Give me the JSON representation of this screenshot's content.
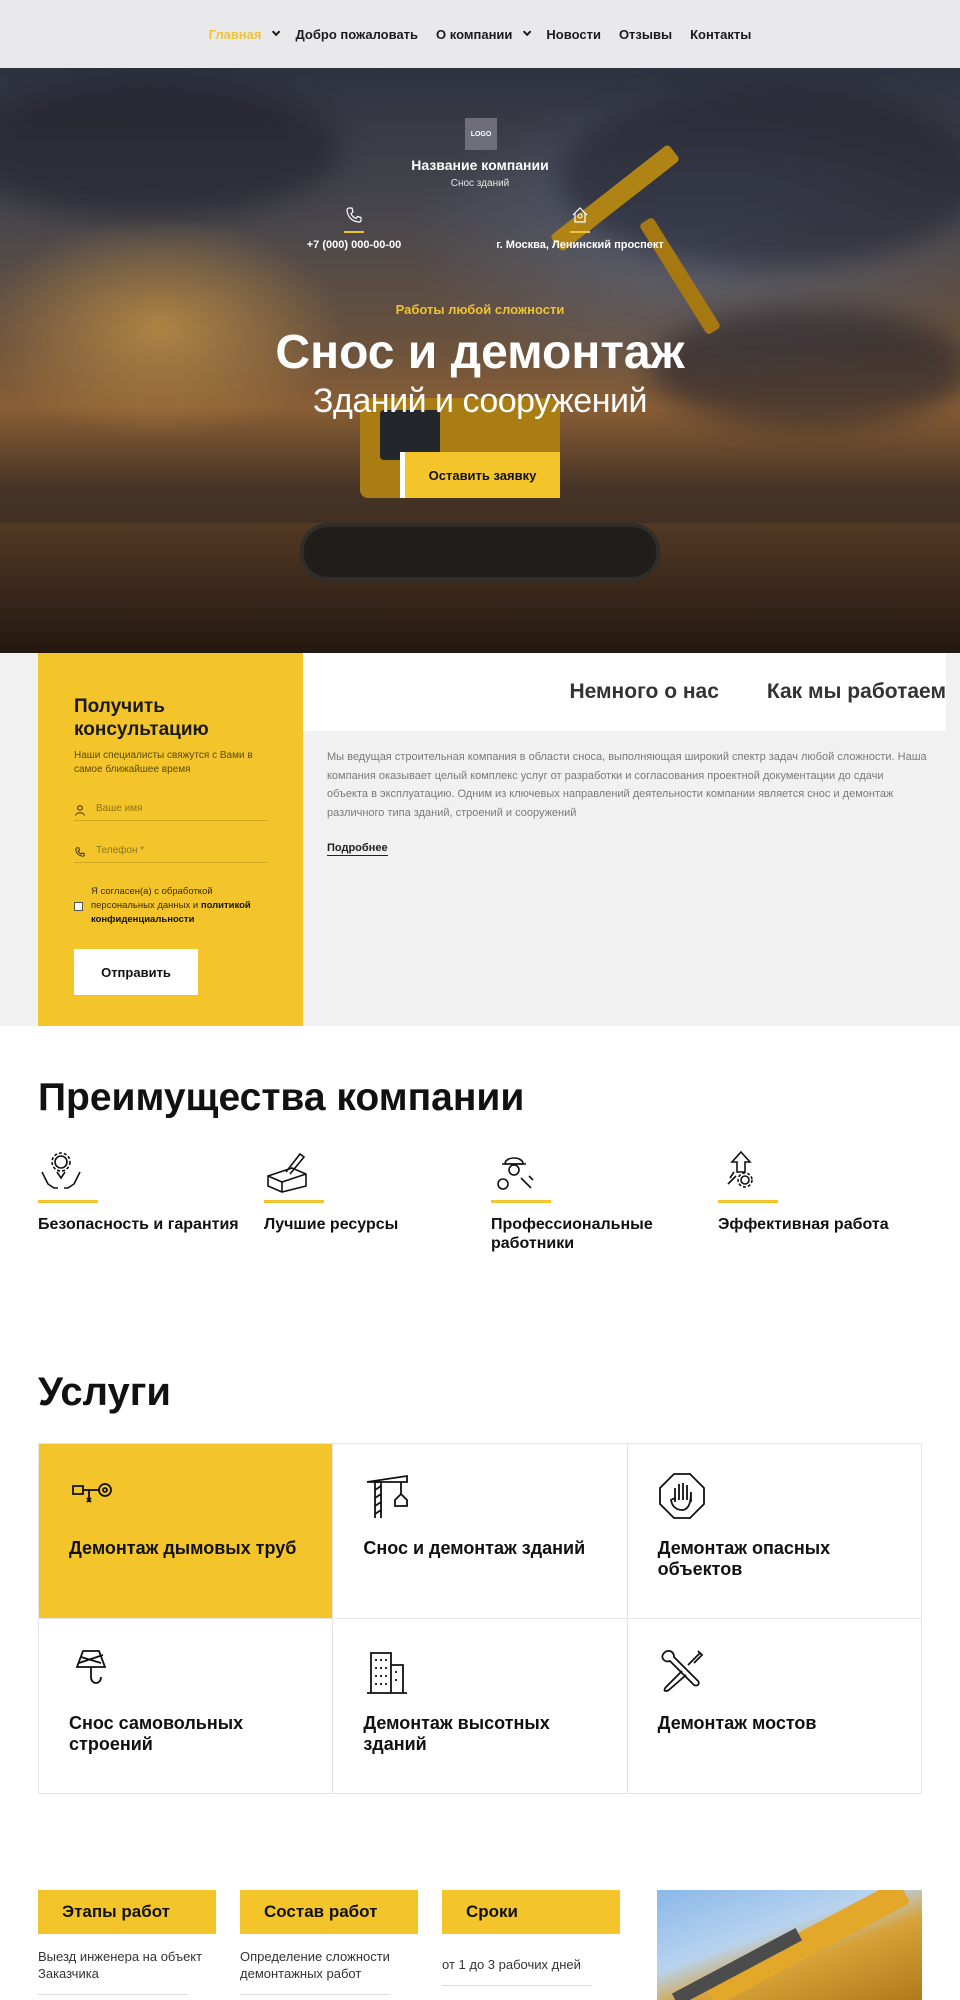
{
  "nav": {
    "items": [
      {
        "label": "Главная",
        "dropdown": true,
        "active": true
      },
      {
        "label": "Добро пожаловать",
        "dropdown": false
      },
      {
        "label": "О компании",
        "dropdown": true
      },
      {
        "label": "Новости",
        "dropdown": false
      },
      {
        "label": "Отзывы",
        "dropdown": false
      },
      {
        "label": "Контакты",
        "dropdown": false
      }
    ]
  },
  "hero": {
    "logo": "LOGO",
    "company_name": "Название компании",
    "company_sub": "Снос зданий",
    "phone": "+7 (000) 000-00-00",
    "address": "г. Москва, Ленинский проспект",
    "kicker": "Работы любой сложности",
    "title": "Снос и демонтаж",
    "subtitle": "Зданий и сооружений",
    "cta": "Оставить заявку"
  },
  "consult": {
    "title": "Получить консультацию",
    "note": "Наши специалисты свяжутся с Вами в самое ближайшее время",
    "name_placeholder": "Ваше имя",
    "phone_placeholder": "Телефон *",
    "agree_text": "Я согласен(а) с обработкой персональных данных и",
    "agree_link": "политикой конфиденциальности",
    "submit": "Отправить"
  },
  "about": {
    "tabs": [
      "Немного о нас",
      "Как мы работаем"
    ],
    "text": "Мы ведущая строительная компания в области сноса, выполняющая широкий спектр задач любой сложности. Наша компания оказывает целый комплекс услуг от разработки и согласования проектной документации до сдачи объекта в эксплуатацию. Одним из ключевых направлений деятельности компании является снос и демонтаж различного типа зданий, строений и сооружений",
    "more": "Подробнее"
  },
  "advantages": {
    "title": "Преимущества компании",
    "items": [
      {
        "label": "Безопасность и гарантия",
        "icon": "hands-gear-icon"
      },
      {
        "label": "Лучшие ресурсы",
        "icon": "brick-trowel-icon"
      },
      {
        "label": "Профессиональные работники",
        "icon": "worker-helmet-icon"
      },
      {
        "label": "Эффективная работа",
        "icon": "arrow-up-gear-icon"
      }
    ]
  },
  "services": {
    "title": "Услуги",
    "items": [
      {
        "label": "Демонтаж дымовых труб",
        "icon": "hook-icon",
        "highlight": true
      },
      {
        "label": "Снос и демонтаж зданий",
        "icon": "crane-icon",
        "highlight": false
      },
      {
        "label": "Демонтаж опасных объектов",
        "icon": "stop-hand-icon",
        "highlight": false
      },
      {
        "label": "Снос самовольных строений",
        "icon": "crane-hook-icon",
        "highlight": false
      },
      {
        "label": "Демонтаж высотных зданий",
        "icon": "building-icon",
        "highlight": false
      },
      {
        "label": "Демонтаж мостов",
        "icon": "tools-icon",
        "highlight": false
      }
    ]
  },
  "stages": {
    "items": [
      {
        "title": "Этапы работ",
        "desc": "Выезд инженера на объект Заказчика"
      },
      {
        "title": "Состав работ",
        "desc": "Определение сложности демонтажных работ"
      },
      {
        "title": "Сроки",
        "desc": "от 1 до 3 рабочих дней"
      }
    ]
  },
  "colors": {
    "accent": "#f3c52a",
    "nav_bg": "#e9e9ec",
    "grey_bg": "#f1f1f2"
  }
}
